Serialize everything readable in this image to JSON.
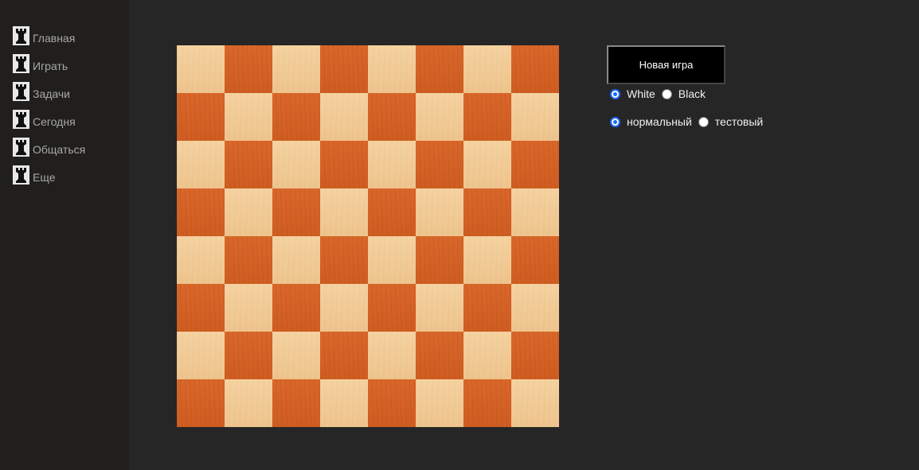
{
  "nav": {
    "items": [
      {
        "label": "Главная",
        "icon": "rook-icon"
      },
      {
        "label": "Играть",
        "icon": "rook-icon"
      },
      {
        "label": "Задачи",
        "icon": "rook-icon"
      },
      {
        "label": "Сегодня",
        "icon": "rook-icon"
      },
      {
        "label": "Общаться",
        "icon": "rook-icon"
      },
      {
        "label": "Еще",
        "icon": "rook-icon"
      }
    ]
  },
  "board": {
    "files": 8,
    "ranks": 8,
    "light_color": "#f4d2a0",
    "dark_color": "#d9662a"
  },
  "controls": {
    "new_game_label": "Новая игра",
    "color": {
      "options": [
        "White",
        "Black"
      ],
      "selected": "White"
    },
    "mode": {
      "options": [
        "нормальный",
        "тестовый"
      ],
      "selected": "нормальный"
    },
    "accent_color": "#1a66ff"
  }
}
